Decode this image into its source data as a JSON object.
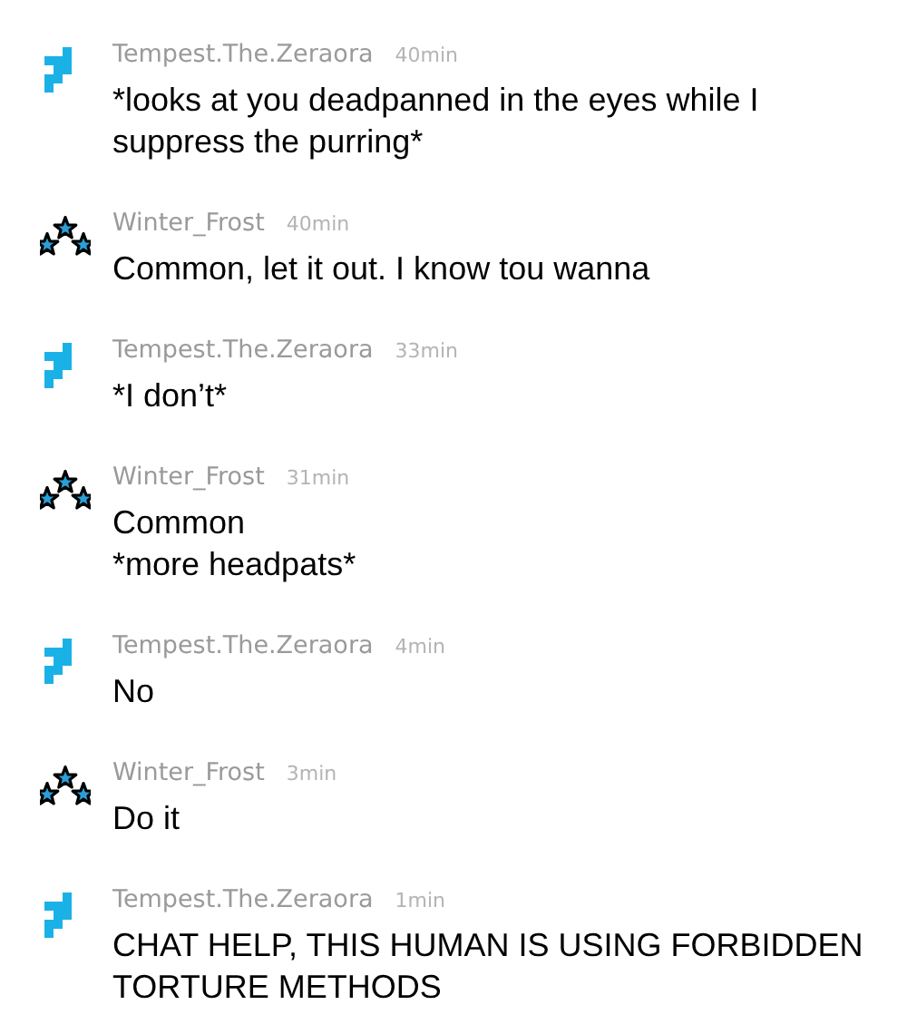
{
  "messages": [
    {
      "kind": "pixel",
      "user": "Tempest.The.Zeraora",
      "time": "40min",
      "lines": [
        "*looks at you deadpanned in the eyes while I suppress the purring*"
      ]
    },
    {
      "kind": "stars",
      "user": "Winter_Frost",
      "time": "40min",
      "lines": [
        "Common, let it out. I know tou wanna"
      ]
    },
    {
      "kind": "pixel",
      "user": "Tempest.The.Zeraora",
      "time": "33min",
      "lines": [
        "*I don’t*"
      ]
    },
    {
      "kind": "stars",
      "user": "Winter_Frost",
      "time": "31min",
      "lines": [
        "Common",
        "*more headpats*"
      ]
    },
    {
      "kind": "pixel",
      "user": "Tempest.The.Zeraora",
      "time": "4min",
      "lines": [
        "No"
      ]
    },
    {
      "kind": "stars",
      "user": "Winter_Frost",
      "time": "3min",
      "lines": [
        "Do it"
      ]
    },
    {
      "kind": "pixel",
      "user": "Tempest.The.Zeraora",
      "time": "1min",
      "lines": [
        "CHAT HELP, THIS HUMAN IS USING FORBIDDEN TORTURE METHODS"
      ]
    }
  ]
}
